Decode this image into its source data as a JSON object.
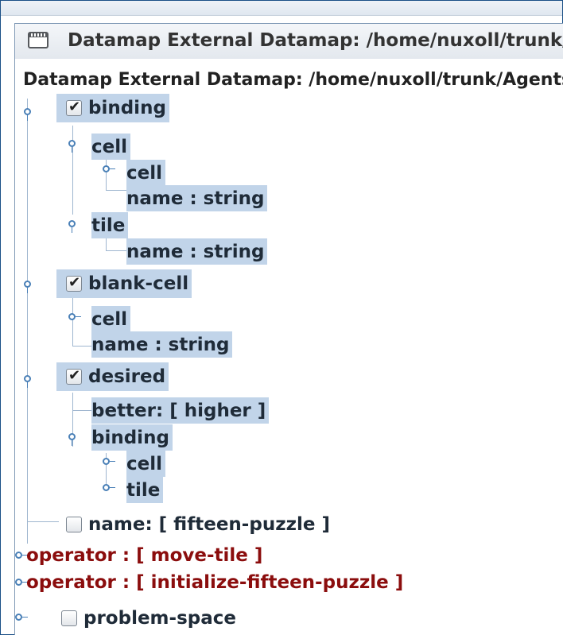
{
  "window": {
    "title": "Datamap External Datamap: /home/nuxoll/trunk/Agents/fifteen-puzzle"
  },
  "tree": {
    "root_label": "Datamap External Datamap: /home/nuxoll/trunk/Agents/fifteen-puzzle",
    "binding": {
      "label": "binding",
      "checked": true,
      "cell": {
        "label": "cell",
        "child_cell": "cell",
        "child_name": "name : string"
      },
      "tile": {
        "label": "tile",
        "child_name": "name : string"
      }
    },
    "blank_cell": {
      "label": "blank-cell",
      "checked": true,
      "cell": "cell",
      "name": "name : string"
    },
    "desired": {
      "label": "desired",
      "checked": true,
      "better": "better: [ higher ]",
      "binding": {
        "label": "binding",
        "cell": "cell",
        "tile": "tile"
      }
    },
    "name_node": {
      "label": "name: [ fifteen-puzzle ]",
      "checked": false
    },
    "operator_move": "operator : [ move-tile ]",
    "operator_init": "operator : [ initialize-fifteen-puzzle ]",
    "problem_space": {
      "label": "problem-space",
      "checked": false
    }
  },
  "colors": {
    "selection": "#c1d4e9",
    "operator_text": "#8b0d0d",
    "tree_line": "#9fb6cf",
    "handle": "#4a80b7",
    "frame": "#1a4f86"
  }
}
